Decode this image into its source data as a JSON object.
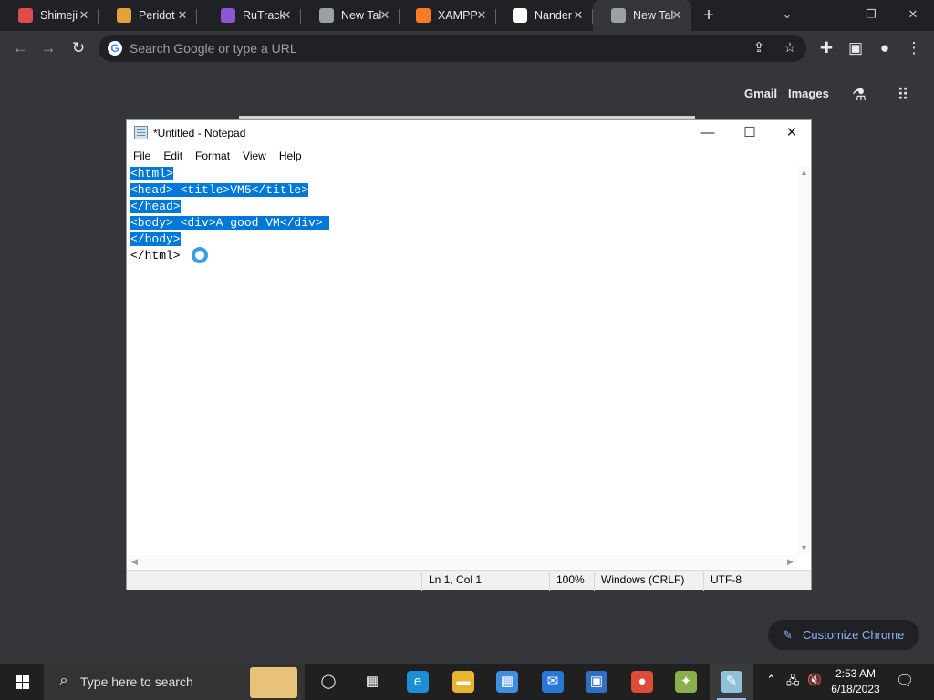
{
  "chrome": {
    "tabs": [
      {
        "title": "Shimeji",
        "icon": "bookmark-icon",
        "color": "#e04b4b"
      },
      {
        "title": "Peridot",
        "icon": "peridot-icon",
        "color": "#e3a13a"
      },
      {
        "title": "RuTrack",
        "icon": "rutracker-icon",
        "color": "#8c55d6"
      },
      {
        "title": "New Tal",
        "icon": "chrome-icon",
        "color": "#9aa0a6"
      },
      {
        "title": "XAMPP",
        "icon": "xampp-icon",
        "color": "#fb7a24"
      },
      {
        "title": "Nander",
        "icon": "github-icon",
        "color": "#ffffff"
      },
      {
        "title": "New Tal",
        "icon": "chrome-icon",
        "color": "#9aa0a6"
      }
    ],
    "new_tab": "+",
    "omnibox_placeholder": "Search Google or type a URL",
    "ntp_gmail": "Gmail",
    "ntp_images": "Images",
    "customize_label": "Customize Chrome"
  },
  "notepad": {
    "title": "*Untitled - Notepad",
    "menu": [
      "File",
      "Edit",
      "Format",
      "View",
      "Help"
    ],
    "lines": [
      {
        "text": "<html>",
        "selected": true
      },
      {
        "text": "<head> <title>VM5</title>",
        "selected": true
      },
      {
        "text": "</head>",
        "selected": true
      },
      {
        "text": "<body> <div>A good VM</div> ",
        "selected": true
      },
      {
        "text": "</body>",
        "selected": true
      },
      {
        "text": "</html>",
        "selected": false
      }
    ],
    "status": {
      "position": "Ln 1, Col 1",
      "zoom": "100%",
      "line_ending": "Windows (CRLF)",
      "encoding": "UTF-8"
    },
    "selection_color": "#0078d7"
  },
  "taskbar": {
    "search_placeholder": "Type here to search",
    "apps": [
      {
        "name": "task-view-icon",
        "glyph": "◯",
        "color": "transparent"
      },
      {
        "name": "widgets-icon",
        "glyph": "▦",
        "color": "transparent"
      },
      {
        "name": "edge-icon",
        "glyph": "e",
        "color": "#1b8ed6"
      },
      {
        "name": "file-explorer-icon",
        "glyph": "▬",
        "color": "#e8b530"
      },
      {
        "name": "store-icon",
        "glyph": "▦",
        "color": "#3f8ee0"
      },
      {
        "name": "mail-icon",
        "glyph": "✉",
        "color": "#2a78d6"
      },
      {
        "name": "image-viewer-icon",
        "glyph": "▣",
        "color": "#2f6fc4"
      },
      {
        "name": "chrome-icon",
        "glyph": "●",
        "color": "#dd4b39"
      },
      {
        "name": "app-icon",
        "glyph": "✦",
        "color": "#8ab04a"
      },
      {
        "name": "notepad-icon",
        "glyph": "✎",
        "color": "#8fc1dd"
      }
    ],
    "time": "2:53 AM",
    "date": "6/18/2023"
  }
}
